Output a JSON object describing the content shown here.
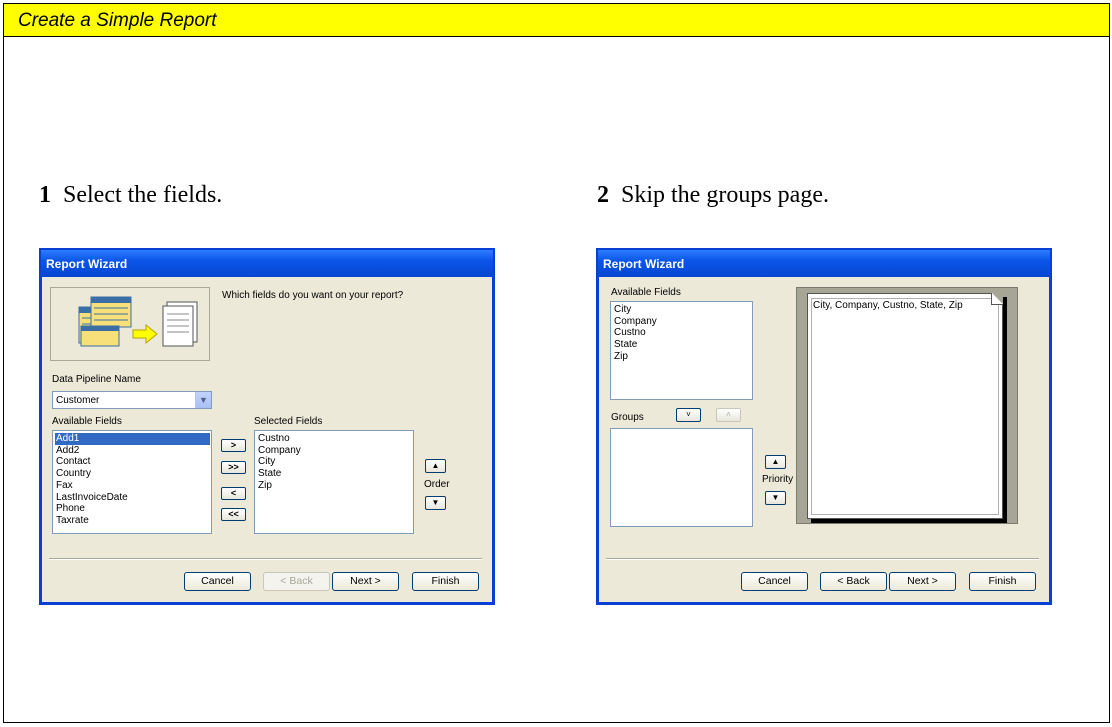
{
  "banner": {
    "title": "Create a Simple Report"
  },
  "step1": {
    "number": "1",
    "text": "Select the fields.",
    "dialog": {
      "title": "Report Wizard",
      "prompt": "Which fields do you want on your report?",
      "pipeline_label": "Data Pipeline Name",
      "pipeline_value": "Customer",
      "available_label": "Available Fields",
      "available_fields": [
        "Add1",
        "Add2",
        "Contact",
        "Country",
        "Fax",
        "LastInvoiceDate",
        "Phone",
        "Taxrate"
      ],
      "selected_label": "Selected Fields",
      "selected_fields": [
        "Custno",
        "Company",
        "City",
        "State",
        "Zip"
      ],
      "move_right": ">",
      "move_all_right": ">>",
      "move_left": "<",
      "move_all_left": "<<",
      "order_label": "Order",
      "cancel": "Cancel",
      "back": "< Back",
      "next": "Next >",
      "finish": "Finish"
    }
  },
  "step2": {
    "number": "2",
    "text": "Skip the groups page.",
    "dialog": {
      "title": "Report Wizard",
      "available_label": "Available Fields",
      "available_fields": [
        "City",
        "Company",
        "Custno",
        "State",
        "Zip"
      ],
      "groups_label": "Groups",
      "priority_label": "Priority",
      "preview_text": "City, Company, Custno, State, Zip",
      "cancel": "Cancel",
      "back": "< Back",
      "next": "Next >",
      "finish": "Finish"
    }
  }
}
